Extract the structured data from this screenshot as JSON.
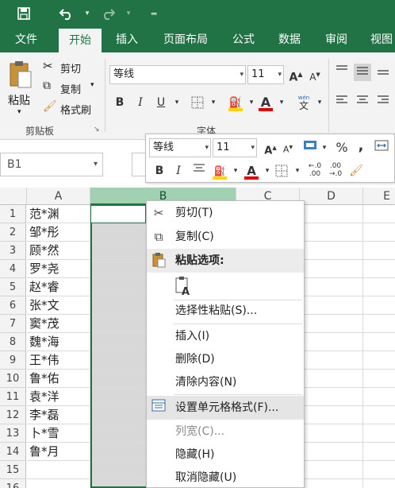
{
  "qat": {
    "save_icon": "save-icon",
    "undo_icon": "undo-icon",
    "redo_icon": "redo-icon",
    "customize_icon": "customize-icon"
  },
  "tabs": [
    {
      "label": "文件"
    },
    {
      "label": "开始"
    },
    {
      "label": "插入"
    },
    {
      "label": "页面布局"
    },
    {
      "label": "公式"
    },
    {
      "label": "数据"
    },
    {
      "label": "审阅"
    },
    {
      "label": "视图"
    }
  ],
  "ribbon": {
    "clipboard": {
      "paste": "粘贴",
      "cut": "剪切",
      "copy": "复制",
      "format_painter": "格式刷",
      "group_label": "剪贴板"
    },
    "font": {
      "font_name": "等线",
      "font_size": "11",
      "group_label": "字体",
      "bold": "B",
      "italic": "I",
      "underline": "U",
      "font_color_letter": "A",
      "grow": "A",
      "shrink": "A",
      "phonetic": "文"
    }
  },
  "namebox": {
    "value": "B1"
  },
  "mini_toolbar": {
    "font_name": "等线",
    "font_size": "11",
    "percent": "%",
    "comma": ",",
    "bold": "B",
    "italic": "I",
    "font_color_letter": "A"
  },
  "columns": [
    {
      "label": "A"
    },
    {
      "label": "B"
    },
    {
      "label": "C"
    },
    {
      "label": "D"
    },
    {
      "label": "E"
    }
  ],
  "rows": [
    {
      "num": "1",
      "a": "范*渊"
    },
    {
      "num": "2",
      "a": "邹*彤"
    },
    {
      "num": "3",
      "a": "顾*然"
    },
    {
      "num": "4",
      "a": "罗*尧"
    },
    {
      "num": "5",
      "a": "赵*睿"
    },
    {
      "num": "6",
      "a": "张*文"
    },
    {
      "num": "7",
      "a": "窦*茂"
    },
    {
      "num": "8",
      "a": "魏*海"
    },
    {
      "num": "9",
      "a": "王*伟"
    },
    {
      "num": "10",
      "a": "鲁*佑"
    },
    {
      "num": "11",
      "a": "袁*洋"
    },
    {
      "num": "12",
      "a": "李*磊"
    },
    {
      "num": "13",
      "a": "卜*雪"
    },
    {
      "num": "14",
      "a": "鲁*月"
    },
    {
      "num": "15",
      "a": ""
    },
    {
      "num": "16",
      "a": ""
    }
  ],
  "context_menu": {
    "cut": "剪切(T)",
    "copy": "复制(C)",
    "paste_options": "粘贴选项:",
    "paste_special": "选择性粘贴(S)...",
    "insert": "插入(I)",
    "delete": "删除(D)",
    "clear": "清除内容(N)",
    "format_cells": "设置单元格格式(F)...",
    "col_width": "列宽(C)...",
    "hide": "隐藏(H)",
    "unhide": "取消隐藏(U)"
  },
  "colors": {
    "brand": "#217346",
    "selected_header": "#a0d2b2",
    "selected_column": "#d8d8d8",
    "highlight_fill": "#ffd400",
    "font_color": "#e00000"
  }
}
